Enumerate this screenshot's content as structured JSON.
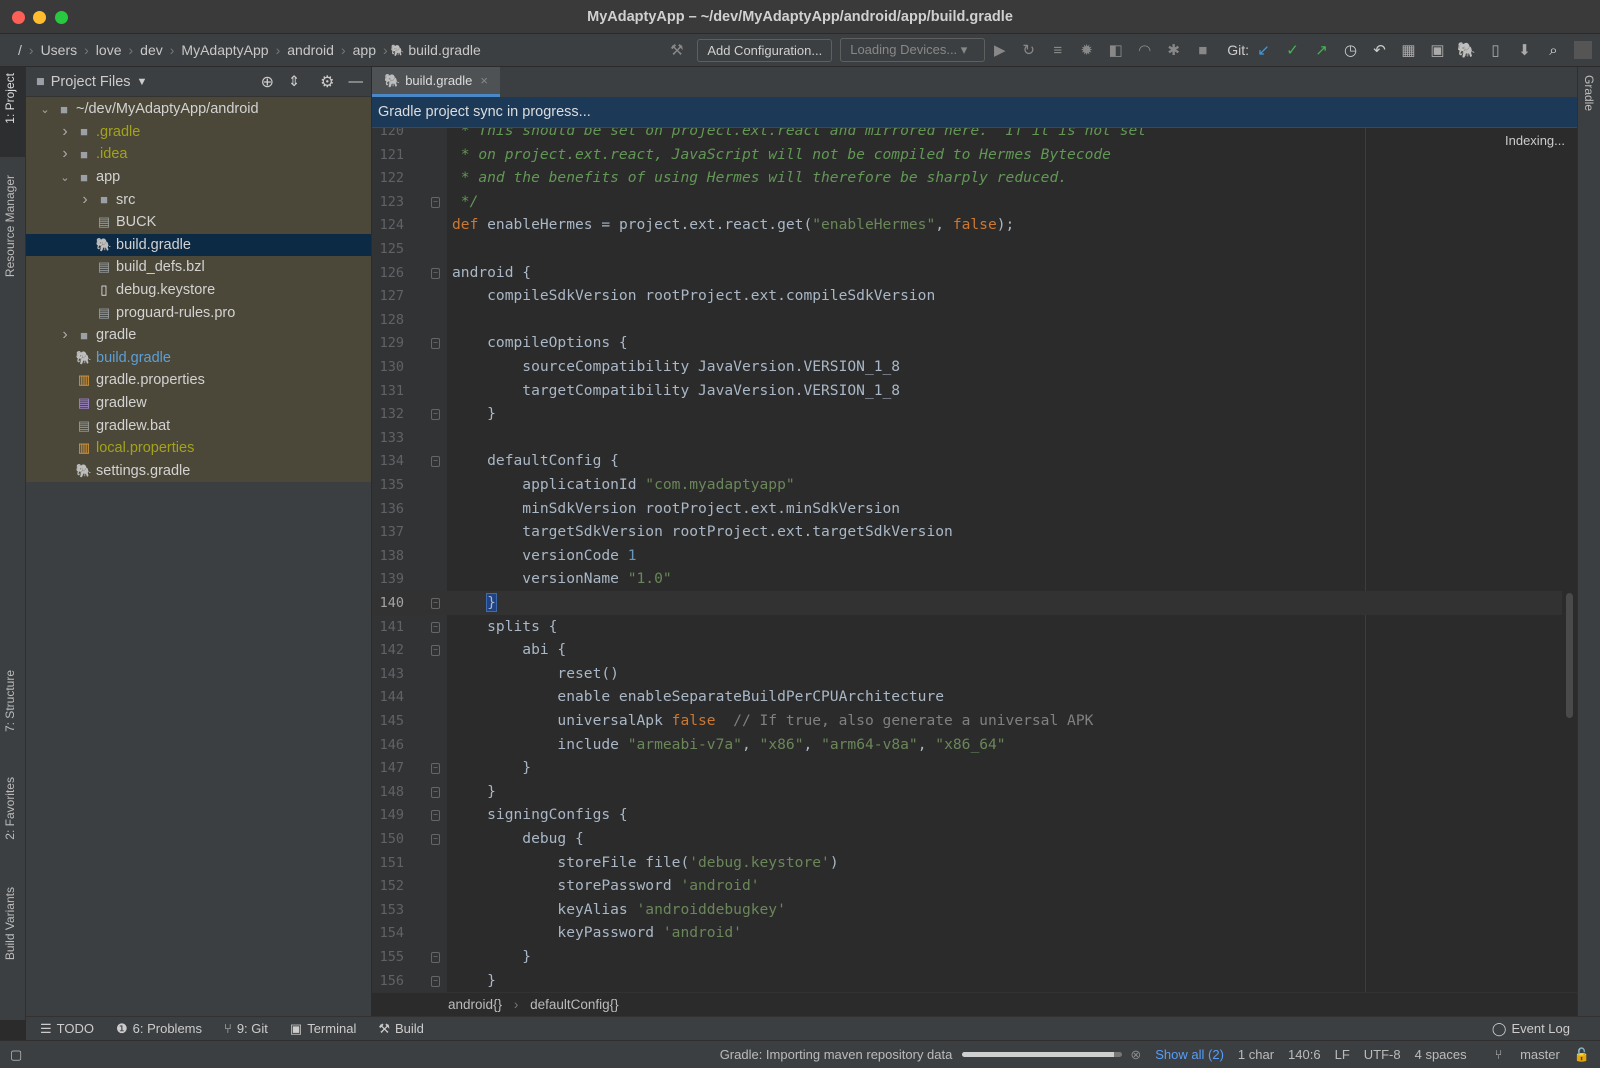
{
  "window": {
    "title": "MyAdaptyApp – ~/dev/MyAdaptyApp/android/app/build.gradle"
  },
  "navbar": {
    "breadcrumbs": [
      "/",
      "Users",
      "love",
      "dev",
      "MyAdaptyApp",
      "android",
      "app",
      "build.gradle"
    ],
    "add_configuration": "Add Configuration...",
    "devices": "Loading Devices...",
    "git_label": "Git:"
  },
  "left_stripe": {
    "project": "1: Project",
    "resource_manager": "Resource Manager",
    "structure": "7: Structure",
    "favorites": "2: Favorites",
    "build_variants": "Build Variants"
  },
  "right_stripe": {
    "gradle": "Gradle"
  },
  "project_panel": {
    "title": "Project Files",
    "tree": [
      {
        "label": "~/dev/MyAdaptyApp/android",
        "depth": 0,
        "arrow": "open",
        "icon": "folder",
        "color": "#d2d2d2"
      },
      {
        "label": ".gradle",
        "depth": 1,
        "arrow": "closed",
        "icon": "folder",
        "color": "#a4a21a"
      },
      {
        "label": ".idea",
        "depth": 1,
        "arrow": "closed",
        "icon": "folder",
        "color": "#a4a21a"
      },
      {
        "label": "app",
        "depth": 1,
        "arrow": "open",
        "icon": "folder",
        "color": "#d2d2d2"
      },
      {
        "label": "src",
        "depth": 2,
        "arrow": "closed",
        "icon": "folder",
        "color": "#d2d2d2"
      },
      {
        "label": "BUCK",
        "depth": 2,
        "arrow": "none",
        "icon": "text-file",
        "color": "#d2d2d2"
      },
      {
        "label": "build.gradle",
        "depth": 2,
        "arrow": "none",
        "icon": "gradle",
        "color": "#d2d2d2",
        "selected": true
      },
      {
        "label": "build_defs.bzl",
        "depth": 2,
        "arrow": "none",
        "icon": "text-file",
        "color": "#d2d2d2"
      },
      {
        "label": "debug.keystore",
        "depth": 2,
        "arrow": "none",
        "icon": "file",
        "color": "#d2d2d2"
      },
      {
        "label": "proguard-rules.pro",
        "depth": 2,
        "arrow": "none",
        "icon": "text-file",
        "color": "#d2d2d2"
      },
      {
        "label": "gradle",
        "depth": 1,
        "arrow": "closed",
        "icon": "folder",
        "color": "#d2d2d2"
      },
      {
        "label": "build.gradle",
        "depth": 1,
        "arrow": "none",
        "icon": "gradle",
        "color": "#5d9fd6"
      },
      {
        "label": "gradle.properties",
        "depth": 1,
        "arrow": "none",
        "icon": "properties",
        "color": "#d2d2d2"
      },
      {
        "label": "gradlew",
        "depth": 1,
        "arrow": "none",
        "icon": "script",
        "color": "#d2d2d2"
      },
      {
        "label": "gradlew.bat",
        "depth": 1,
        "arrow": "none",
        "icon": "text-file",
        "color": "#d2d2d2"
      },
      {
        "label": "local.properties",
        "depth": 1,
        "arrow": "none",
        "icon": "properties",
        "color": "#a4a21a"
      },
      {
        "label": "settings.gradle",
        "depth": 1,
        "arrow": "none",
        "icon": "gradle",
        "color": "#d2d2d2"
      }
    ]
  },
  "editor": {
    "tab": "build.gradle",
    "banner": "Gradle project sync in progress...",
    "indexing": "Indexing...",
    "caret_line": 140,
    "lines": [
      {
        "n": 120,
        "fold": false,
        "tokens": [
          {
            "t": "c",
            "v": " * This should be set on project.ext.react and mirrored here.  If it is not set"
          }
        ]
      },
      {
        "n": 121,
        "fold": false,
        "tokens": [
          {
            "t": "c",
            "v": " * on project.ext.react, JavaScript will not be compiled to Hermes Bytecode"
          }
        ]
      },
      {
        "n": 122,
        "fold": false,
        "tokens": [
          {
            "t": "c",
            "v": " * and the benefits of using Hermes will therefore be sharply reduced."
          }
        ]
      },
      {
        "n": 123,
        "fold": true,
        "tokens": [
          {
            "t": "c",
            "v": " */"
          }
        ]
      },
      {
        "n": 124,
        "fold": false,
        "tokens": [
          {
            "t": "k",
            "v": "def"
          },
          {
            "t": "p",
            "v": " enableHermes = project.ext.react.get("
          },
          {
            "t": "s",
            "v": "\"enableHermes\""
          },
          {
            "t": "p",
            "v": ", "
          },
          {
            "t": "k",
            "v": "false"
          },
          {
            "t": "p",
            "v": ");"
          }
        ]
      },
      {
        "n": 125,
        "fold": false,
        "tokens": []
      },
      {
        "n": 126,
        "fold": true,
        "tokens": [
          {
            "t": "p",
            "v": "android {"
          }
        ]
      },
      {
        "n": 127,
        "fold": false,
        "tokens": [
          {
            "t": "p",
            "v": "    compileSdkVersion rootProject.ext.compileSdkVersion"
          }
        ]
      },
      {
        "n": 128,
        "fold": false,
        "tokens": []
      },
      {
        "n": 129,
        "fold": true,
        "tokens": [
          {
            "t": "p",
            "v": "    compileOptions {"
          }
        ]
      },
      {
        "n": 130,
        "fold": false,
        "tokens": [
          {
            "t": "p",
            "v": "        sourceCompatibility JavaVersion.VERSION_1_8"
          }
        ]
      },
      {
        "n": 131,
        "fold": false,
        "tokens": [
          {
            "t": "p",
            "v": "        targetCompatibility JavaVersion.VERSION_1_8"
          }
        ]
      },
      {
        "n": 132,
        "fold": true,
        "tokens": [
          {
            "t": "p",
            "v": "    }"
          }
        ]
      },
      {
        "n": 133,
        "fold": false,
        "tokens": []
      },
      {
        "n": 134,
        "fold": true,
        "tokens": [
          {
            "t": "p",
            "v": "    defaultConfig {"
          }
        ]
      },
      {
        "n": 135,
        "fold": false,
        "tokens": [
          {
            "t": "p",
            "v": "        applicationId "
          },
          {
            "t": "s",
            "v": "\"com.myadaptyapp\""
          }
        ]
      },
      {
        "n": 136,
        "fold": false,
        "tokens": [
          {
            "t": "p",
            "v": "        minSdkVersion rootProject.ext.minSdkVersion"
          }
        ]
      },
      {
        "n": 137,
        "fold": false,
        "tokens": [
          {
            "t": "p",
            "v": "        targetSdkVersion rootProject.ext.targetSdkVersion"
          }
        ]
      },
      {
        "n": 138,
        "fold": false,
        "tokens": [
          {
            "t": "p",
            "v": "        versionCode "
          },
          {
            "t": "n",
            "v": "1"
          }
        ]
      },
      {
        "n": 139,
        "fold": false,
        "tokens": [
          {
            "t": "p",
            "v": "        versionName "
          },
          {
            "t": "s",
            "v": "\"1.0\""
          }
        ]
      },
      {
        "n": 140,
        "fold": true,
        "tokens": [
          {
            "t": "p",
            "v": "    "
          },
          {
            "t": "m",
            "v": "}"
          }
        ]
      },
      {
        "n": 141,
        "fold": true,
        "tokens": [
          {
            "t": "p",
            "v": "    splits {"
          }
        ]
      },
      {
        "n": 142,
        "fold": true,
        "tokens": [
          {
            "t": "p",
            "v": "        abi {"
          }
        ]
      },
      {
        "n": 143,
        "fold": false,
        "tokens": [
          {
            "t": "p",
            "v": "            reset()"
          }
        ]
      },
      {
        "n": 144,
        "fold": false,
        "tokens": [
          {
            "t": "p",
            "v": "            enable enableSeparateBuildPerCPUArchitecture"
          }
        ]
      },
      {
        "n": 145,
        "fold": false,
        "tokens": [
          {
            "t": "p",
            "v": "            universalApk "
          },
          {
            "t": "k",
            "v": "false"
          },
          {
            "t": "lc",
            "v": "  // If true, also generate a universal APK"
          }
        ]
      },
      {
        "n": 146,
        "fold": false,
        "tokens": [
          {
            "t": "p",
            "v": "            include "
          },
          {
            "t": "s",
            "v": "\"armeabi-v7a\""
          },
          {
            "t": "p",
            "v": ", "
          },
          {
            "t": "s",
            "v": "\"x86\""
          },
          {
            "t": "p",
            "v": ", "
          },
          {
            "t": "s",
            "v": "\"arm64-v8a\""
          },
          {
            "t": "p",
            "v": ", "
          },
          {
            "t": "s",
            "v": "\"x86_64\""
          }
        ]
      },
      {
        "n": 147,
        "fold": true,
        "tokens": [
          {
            "t": "p",
            "v": "        }"
          }
        ]
      },
      {
        "n": 148,
        "fold": true,
        "tokens": [
          {
            "t": "p",
            "v": "    }"
          }
        ]
      },
      {
        "n": 149,
        "fold": true,
        "tokens": [
          {
            "t": "p",
            "v": "    signingConfigs {"
          }
        ]
      },
      {
        "n": 150,
        "fold": true,
        "tokens": [
          {
            "t": "p",
            "v": "        debug {"
          }
        ]
      },
      {
        "n": 151,
        "fold": false,
        "tokens": [
          {
            "t": "p",
            "v": "            storeFile file("
          },
          {
            "t": "s",
            "v": "'debug.keystore'"
          },
          {
            "t": "p",
            "v": ")"
          }
        ]
      },
      {
        "n": 152,
        "fold": false,
        "tokens": [
          {
            "t": "p",
            "v": "            storePassword "
          },
          {
            "t": "s",
            "v": "'android'"
          }
        ]
      },
      {
        "n": 153,
        "fold": false,
        "tokens": [
          {
            "t": "p",
            "v": "            keyAlias "
          },
          {
            "t": "s",
            "v": "'androiddebugkey'"
          }
        ]
      },
      {
        "n": 154,
        "fold": false,
        "tokens": [
          {
            "t": "p",
            "v": "            keyPassword "
          },
          {
            "t": "s",
            "v": "'android'"
          }
        ]
      },
      {
        "n": 155,
        "fold": true,
        "tokens": [
          {
            "t": "p",
            "v": "        }"
          }
        ]
      },
      {
        "n": 156,
        "fold": true,
        "tokens": [
          {
            "t": "p",
            "v": "    }"
          }
        ]
      }
    ],
    "breadcrumbs": [
      "android{}",
      "defaultConfig{}"
    ]
  },
  "tool_windows": {
    "todo": "TODO",
    "problems": "6: Problems",
    "git": "9: Git",
    "terminal": "Terminal",
    "build": "Build",
    "event_log": "Event Log"
  },
  "status": {
    "task": "Gradle: Importing maven repository data",
    "progress": 0.95,
    "show_all": "Show all (2)",
    "selection": "1 char",
    "position": "140:6",
    "line_sep": "LF",
    "encoding": "UTF-8",
    "indent": "4 spaces",
    "branch": "master"
  },
  "colors": {
    "accent": "#4a88c7",
    "banner": "#1c3a58",
    "keyword": "#cc7832",
    "string": "#6a8759",
    "comment": "#629755",
    "number": "#6897bb"
  }
}
